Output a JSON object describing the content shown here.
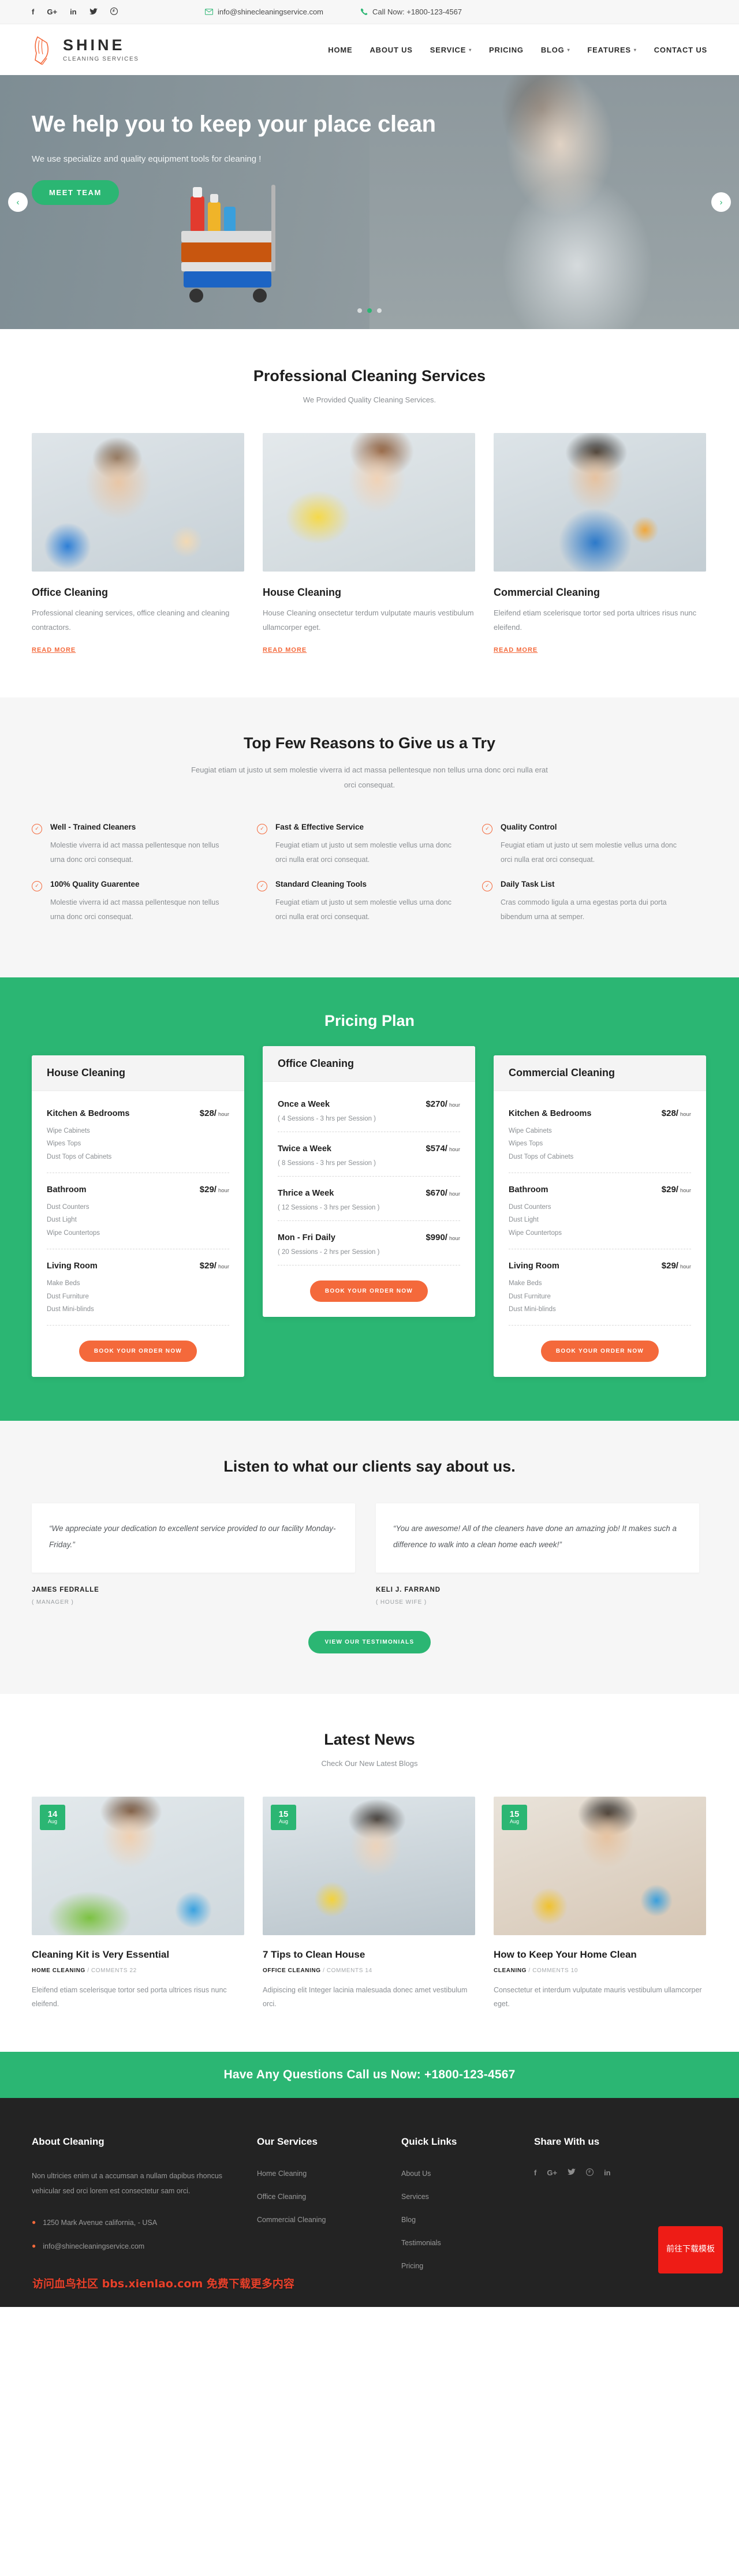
{
  "topbar": {
    "social": [
      {
        "name": "facebook-icon",
        "glyph": "f"
      },
      {
        "name": "google-plus-icon",
        "glyph": "G+"
      },
      {
        "name": "linkedin-icon",
        "glyph": "in"
      },
      {
        "name": "twitter-icon",
        "glyph": "ᴠ"
      },
      {
        "name": "pinterest-icon",
        "glyph": "Ⓟ"
      }
    ],
    "email": "info@shinecleaningservice.com",
    "phone": "Call Now: +1800-123-4567"
  },
  "brand": {
    "name": "SHINE",
    "tagline": "CLEANING SERVICES"
  },
  "menu": [
    {
      "label": "HOME",
      "caret": false
    },
    {
      "label": "ABOUT US",
      "caret": false
    },
    {
      "label": "SERVICE",
      "caret": true
    },
    {
      "label": "PRICING",
      "caret": false
    },
    {
      "label": "BLOG",
      "caret": true
    },
    {
      "label": "FEATURES",
      "caret": true
    },
    {
      "label": "CONTACT US",
      "caret": false
    }
  ],
  "hero": {
    "title": "We help you to keep your place clean",
    "subtitle": "We use specialize and quality equipment tools for cleaning !",
    "cta": "MEET TEAM",
    "prev": "‹",
    "next": "›"
  },
  "services": {
    "title": "Professional Cleaning Services",
    "subtitle": "We Provided Quality Cleaning Services.",
    "readmore": "READ MORE",
    "cards": [
      {
        "title": "Office Cleaning",
        "text": "Professional cleaning services, office cleaning and cleaning contractors."
      },
      {
        "title": "House Cleaning",
        "text": "House Cleaning onsectetur terdum vulputate mauris vestibulum ullamcorper eget."
      },
      {
        "title": "Commercial Cleaning",
        "text": "Eleifend etiam scelerisque tortor sed porta ultrices risus nunc eleifend."
      }
    ]
  },
  "reasons": {
    "title": "Top Few Reasons to Give us a Try",
    "subtitle": "Feugiat etiam ut justo ut sem molestie viverra id act massa pellentesque non tellus urna donc orci nulla erat orci consequat.",
    "items": [
      {
        "title": "Well - Trained Cleaners",
        "text": "Molestie viverra id act massa pellentesque non tellus urna donc orci consequat."
      },
      {
        "title": "Fast & Effective Service",
        "text": "Feugiat etiam ut justo ut sem molestie vellus urna donc orci nulla erat orci consequat."
      },
      {
        "title": "Quality Control",
        "text": "Feugiat etiam ut justo ut sem molestie vellus urna donc orci nulla erat orci consequat."
      },
      {
        "title": "100% Quality Guarentee",
        "text": "Molestie viverra id act massa pellentesque non tellus urna donc orci consequat."
      },
      {
        "title": "Standard Cleaning Tools",
        "text": "Feugiat etiam ut justo ut sem molestie vellus urna donc orci nulla erat orci consequat."
      },
      {
        "title": "Daily Task List",
        "text": "Cras commodo ligula a urna egestas porta dui porta bibendum urna at semper."
      }
    ]
  },
  "pricing": {
    "title": "Pricing Plan",
    "book_label": "BOOK YOUR ORDER NOW",
    "plans": [
      {
        "title": "House Cleaning",
        "rows": [
          {
            "name": "Kitchen & Bedrooms",
            "price": "$28/",
            "unit": "hour",
            "feats": [
              "Wipe Cabinets",
              "Wipes Tops",
              "Dust Tops of Cabinets"
            ]
          },
          {
            "name": "Bathroom",
            "price": "$29/",
            "unit": "hour",
            "feats": [
              "Dust Counters",
              "Dust Light",
              "Wipe Countertops"
            ]
          },
          {
            "name": "Living Room",
            "price": "$29/",
            "unit": "hour",
            "feats": [
              "Make Beds",
              "Dust Furniture",
              "Dust Mini-blinds"
            ]
          }
        ]
      },
      {
        "title": "Office Cleaning",
        "rows": [
          {
            "name": "Once a Week",
            "price": "$270/",
            "unit": "hour",
            "note": "( 4 Sessions - 3 hrs per Session )"
          },
          {
            "name": "Twice a Week",
            "price": "$574/",
            "unit": "hour",
            "note": "( 8 Sessions - 3 hrs per Session )"
          },
          {
            "name": "Thrice a Week",
            "price": "$670/",
            "unit": "hour",
            "note": "( 12 Sessions - 3 hrs per Session )"
          },
          {
            "name": "Mon - Fri Daily",
            "price": "$990/",
            "unit": "hour",
            "note": "( 20 Sessions - 2 hrs per Session )"
          }
        ]
      },
      {
        "title": "Commercial Cleaning",
        "rows": [
          {
            "name": "Kitchen & Bedrooms",
            "price": "$28/",
            "unit": "hour",
            "feats": [
              "Wipe Cabinets",
              "Wipes Tops",
              "Dust Tops of Cabinets"
            ]
          },
          {
            "name": "Bathroom",
            "price": "$29/",
            "unit": "hour",
            "feats": [
              "Dust Counters",
              "Dust Light",
              "Wipe Countertops"
            ]
          },
          {
            "name": "Living Room",
            "price": "$29/",
            "unit": "hour",
            "feats": [
              "Make Beds",
              "Dust Furniture",
              "Dust Mini-blinds"
            ]
          }
        ]
      }
    ]
  },
  "testimonials": {
    "title": "Listen to what our clients say about us.",
    "button": "VIEW OUR TESTIMONIALS",
    "items": [
      {
        "quote": "“We appreciate your dedication to excellent service provided to our facility Monday-Friday.”",
        "name": "JAMES FEDRALLE",
        "role": "( MANAGER )"
      },
      {
        "quote": "“You are awesome! All of the cleaners have done an amazing job! It makes such a difference to walk into a clean home each week!”",
        "name": "KELI J. FARRAND",
        "role": "( HOUSE WIFE )"
      }
    ]
  },
  "news": {
    "title": "Latest News",
    "subtitle": "Check Our New Latest Blogs",
    "posts": [
      {
        "day": "14",
        "month": "Aug",
        "title": "Cleaning Kit is Very Essential",
        "category": "HOME CLEANING",
        "comments": "COMMENTS 22",
        "text": "Eleifend etiam scelerisque tortor sed porta ultrices risus nunc eleifend."
      },
      {
        "day": "15",
        "month": "Aug",
        "title": "7 Tips to Clean House",
        "category": "OFFICE CLEANING",
        "comments": "COMMENTS 14",
        "text": "Adipiscing elit Integer lacinia malesuada donec amet vestibulum orci."
      },
      {
        "day": "15",
        "month": "Aug",
        "title": "How to Keep Your Home Clean",
        "category": "CLEANING",
        "comments": "COMMENTS 10",
        "text": "Consectetur et interdum vulputate mauris vestibulum ullamcorper eget."
      }
    ]
  },
  "cta": {
    "text": "Have Any Questions Call us Now: +1800-123-4567"
  },
  "footer": {
    "about": {
      "heading": "About Cleaning",
      "text": "Non ultricies enim ut a accumsan a nullam dapibus rhoncus vehicular sed orci lorem est consectetur sam orci.",
      "address": "1250 Mark Avenue california, - USA",
      "email": "info@shinecleaningservice.com"
    },
    "services": {
      "heading": "Our Services",
      "items": [
        "Home Cleaning",
        "Office Cleaning",
        "Commercial Cleaning"
      ]
    },
    "quicklinks": {
      "heading": "Quick Links",
      "items": [
        "About Us",
        "Services",
        "Blog",
        "Testimonials",
        "Pricing"
      ]
    },
    "share": {
      "heading": "Share With us",
      "social": [
        {
          "name": "facebook-icon",
          "glyph": "f"
        },
        {
          "name": "google-plus-icon",
          "glyph": "G+"
        },
        {
          "name": "twitter-icon",
          "glyph": "ᴠ"
        },
        {
          "name": "pinterest-icon",
          "glyph": "Ⓟ"
        },
        {
          "name": "linkedin-icon",
          "glyph": "in"
        }
      ]
    }
  },
  "overlay": {
    "watermark": "访问血鸟社区 bbs.xienlao.com 免费下载更多内容",
    "download_button": "前往下载模板"
  },
  "colors": {
    "green": "#2bb673",
    "orange": "#f4693b",
    "dark": "#232323"
  }
}
